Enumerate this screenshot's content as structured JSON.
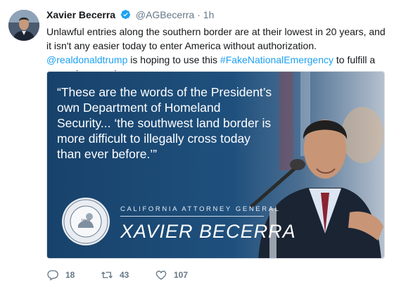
{
  "author": {
    "name": "Xavier Becerra",
    "handle": "@AGBecerra",
    "separator": "·",
    "time": "1h"
  },
  "tweet": {
    "text_1": "Unlawful entries along the southern border are at their lowest in 20 years, and it isn't any easier today to enter America without authorization. ",
    "mention": "@realdonaldtrump",
    "text_2": " is hoping to use this ",
    "hashtag": "#FakeNationalEmergency",
    "text_3": " to fulfill a campaign promise."
  },
  "media": {
    "quote": "“These are the words of the President’s own Department of Homeland Security... ‘the southwest land border is more difficult to illegally cross today than ever before.’”",
    "org_title": "CALIFORNIA ATTORNEY GENERAL",
    "org_name": "XAVIER BECERRA",
    "seal_text": "Liberty and Justice under law",
    "seal_ring": "OFFICE OF THE ATTORNEY GENERAL · CALIFORNIA DEPARTMENT OF JUSTICE"
  },
  "actions": {
    "replies": "18",
    "retweets": "43",
    "likes": "107"
  },
  "colors": {
    "link": "#1da1f2",
    "muted": "#657786",
    "media_blue": "#1d4a73"
  },
  "icons": [
    "verified-badge-icon",
    "reply-icon",
    "retweet-icon",
    "like-icon"
  ]
}
